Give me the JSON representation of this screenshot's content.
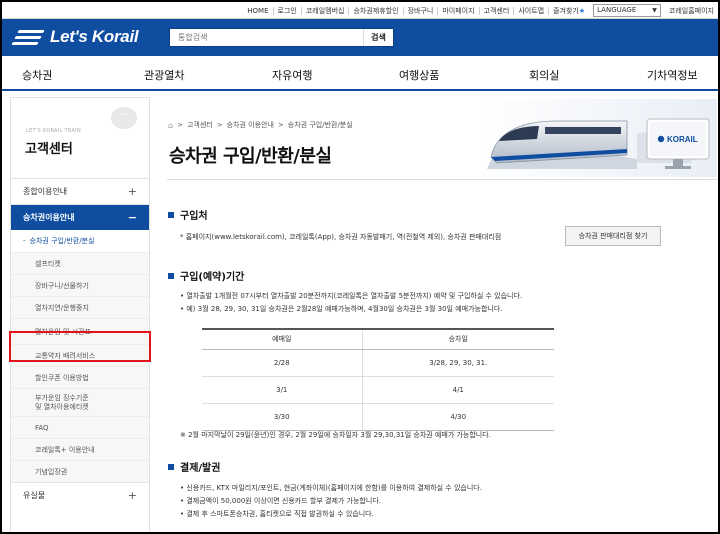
{
  "util_nav": {
    "items": [
      "HOME",
      "로그인",
      "코레일멤버십",
      "승차권제휴할인",
      "장바구니",
      "마이페이지",
      "고객센터",
      "사이트맵",
      "즐겨찾기"
    ],
    "language": "LANGUAGE",
    "extra": "코레일홈페이지"
  },
  "header": {
    "logo_text": "Let's Korail",
    "search_placeholder": "통합검색",
    "search_button": "검색"
  },
  "gnb": [
    "승차권",
    "관광열차",
    "자유여행",
    "여행상품",
    "회의실",
    "기차역정보"
  ],
  "sidebar": {
    "brand_en": "LET'S KORAIL TRAIN",
    "title": "고객센터",
    "section1": "종합이용안내",
    "section2": "승차권이용안내",
    "current_sub": "승차권 구입/반환/분실",
    "subs": [
      "셀프티켓",
      "장바구니/선물하기",
      "열차지연/운행중지",
      "열차운임 및 시간표",
      "교통약자 배려서비스",
      "할인쿠폰 이용방법"
    ],
    "sub_two": [
      "부가운임 징수기준",
      "및 열차이용에티켓"
    ],
    "subs2": [
      "FAQ",
      "코레일톡+ 이용안내",
      "기념입장권"
    ],
    "section3": "유실물"
  },
  "content": {
    "breadcrumb": [
      "고객센터",
      "승차권 이용안내",
      "승차권 구입/반환/분실"
    ],
    "title": "승차권 구입/반환/분실",
    "brand_badge": "KORAIL",
    "sec1": {
      "title": "구입처",
      "line": "* 홈페이지(www.letskorail.com), 코레일톡(App), 승차권 자동발매기, 역(전철역 제외), 승차권 판매대리점",
      "button": "승차권 판매대리점 찾기"
    },
    "sec2": {
      "title": "구입(예약)기간",
      "lines": [
        "• 열차출발 1개월전 07시부터 열차출발 20분전까지(코레일톡은 열차출발 5분전까지) 예약 및 구입하실 수 있습니다.",
        "• 예) 3월 28, 29, 30, 31일 승차권은 2월28일 예매가능하며, 4월30일 승차권은 3월 30일 예매가능합니다."
      ],
      "table_headers": [
        "예매일",
        "승차일"
      ],
      "table_rows": [
        [
          "2/28",
          "3/28, 29, 30, 31."
        ],
        [
          "3/1",
          "4/1"
        ],
        [
          "3/30",
          "4/30"
        ]
      ],
      "note": "※ 2월 마지막날이 29일(윤년)인 경우, 2월 29일에 승차일자 3월 29,30,31일 승차권 예매가 가능합니다."
    },
    "sec3": {
      "title": "결제/발권",
      "lines": [
        "• 신용카드, KTX 마일리지/포인트, 현금(계좌이체)(홈페이지에 한함)를 이용하여 결제하실 수 있습니다.",
        "• 결제금액이 50,000원 이상이면 신용카드 할부 결제가 가능합니다.",
        "• 결제 후 스마트폰승차권, 홈티켓으로 직접 발권하실 수 있습니다."
      ]
    }
  },
  "colors": {
    "brand_blue": "#0e4da0",
    "highlight_red": "#e0151b"
  }
}
